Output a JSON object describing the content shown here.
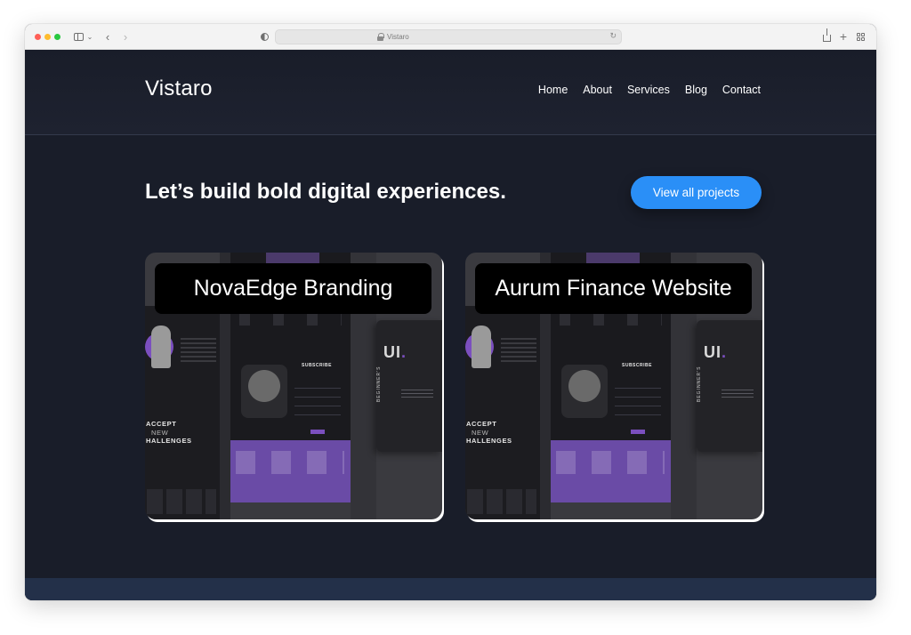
{
  "browser": {
    "url": "Vistaro"
  },
  "site": {
    "logo": "Vistaro",
    "nav": [
      "Home",
      "About",
      "Services",
      "Blog",
      "Contact"
    ]
  },
  "hero": {
    "title": "Let’s build bold digital experiences.",
    "cta": "View all projects"
  },
  "projects": [
    {
      "title": "NovaEdge Branding"
    },
    {
      "title": "Aurum Finance Website"
    }
  ],
  "mockup": {
    "accept_lines": [
      "ACCEPT",
      "NEW",
      "HALLENGES"
    ],
    "subscribe": "SUBSCRIBE",
    "ui_text": "UI",
    "beginners": "BEGINNER'S"
  },
  "colors": {
    "page_bg": "#191d29",
    "accent_blue": "#2a8ff7",
    "purple": "#6a4ba6",
    "footer_band": "#233049"
  }
}
